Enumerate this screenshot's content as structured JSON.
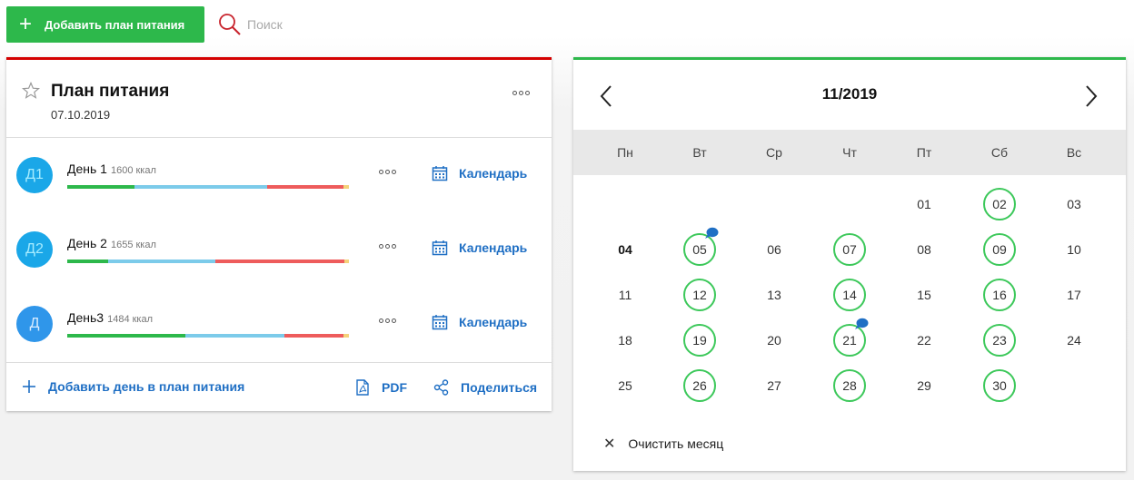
{
  "toolbar": {
    "add_plan_label": "Добавить план питания",
    "search_placeholder": "Поиск"
  },
  "plan": {
    "title": "План питания",
    "date": "07.10.2019",
    "days": [
      {
        "avatar": "Д1",
        "name": "День 1",
        "kcal": "1600 ккал",
        "calendar_label": "Календарь",
        "macros": {
          "protein": 0.24,
          "carbs": 0.47,
          "fat": 0.27,
          "other": 0.02
        }
      },
      {
        "avatar": "Д2",
        "name": "День 2",
        "kcal": "1655 ккал",
        "calendar_label": "Календарь",
        "macros": {
          "protein": 0.145,
          "carbs": 0.38,
          "fat": 0.46,
          "other": 0.015
        }
      },
      {
        "avatar": "Д",
        "name": "День3",
        "kcal": "1484 ккал",
        "calendar_label": "Календарь",
        "macros": {
          "protein": 0.42,
          "carbs": 0.35,
          "fat": 0.21,
          "other": 0.02
        }
      }
    ],
    "footer": {
      "add_day_label": "Добавить день в план питания",
      "pdf_label": "PDF",
      "share_label": "Поделиться"
    }
  },
  "calendar": {
    "month_label": "11/2019",
    "weekdays": [
      "Пн",
      "Вт",
      "Ср",
      "Чт",
      "Пт",
      "Сб",
      "Вс"
    ],
    "first_weekday_index": 4,
    "days": [
      "01",
      "02",
      "03",
      "04",
      "05",
      "06",
      "07",
      "08",
      "09",
      "10",
      "11",
      "12",
      "13",
      "14",
      "15",
      "16",
      "17",
      "18",
      "19",
      "20",
      "21",
      "22",
      "23",
      "24",
      "25",
      "26",
      "27",
      "28",
      "29",
      "30"
    ],
    "marked_days": [
      "02",
      "05",
      "07",
      "09",
      "12",
      "14",
      "16",
      "19",
      "21",
      "23",
      "26",
      "28",
      "30"
    ],
    "comment_days": [
      "05",
      "21"
    ],
    "today": "04",
    "clear_label": "Очистить месяц"
  },
  "colors": {
    "accent_green": "#2db84b",
    "plan_border_red": "#d40000",
    "link_blue": "#1f6fc4",
    "avatar_blue": "#1aa7e8",
    "macro_protein": "#2db84b",
    "macro_carbs": "#7ccbea",
    "macro_fat": "#ee5c5c",
    "macro_other": "#f4d27a",
    "marked_ring": "#3cc85a",
    "comment_bubble": "#1f6fc4"
  },
  "icons": {
    "add": "plus-icon",
    "search": "search-icon",
    "favorite": "star-icon",
    "more": "more-dots-icon",
    "calendar": "calendar-icon",
    "pdf": "pdf-icon",
    "share": "share-icon",
    "prev": "chevron-left-icon",
    "next": "chevron-right-icon",
    "clear": "close-icon",
    "comment": "comment-bubble-icon"
  }
}
